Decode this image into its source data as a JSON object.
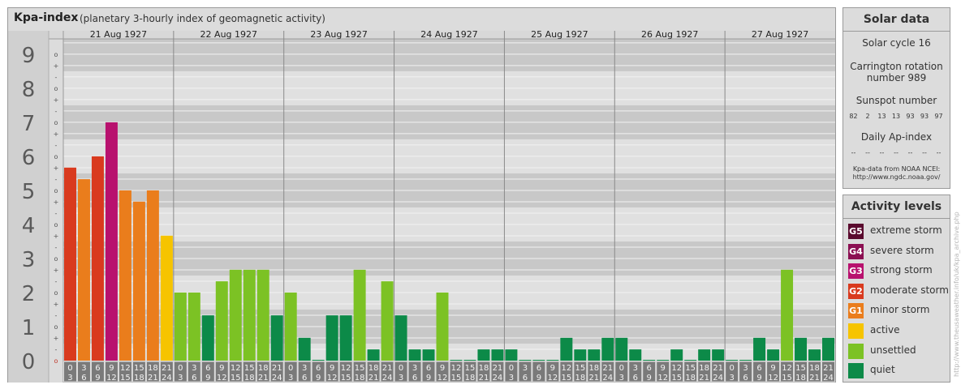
{
  "title": {
    "main": "Kpa-index",
    "sub": "(planetary 3-hourly index of geomagnetic activity)"
  },
  "solar_data": {
    "heading": "Solar data",
    "cycle": "Solar cycle 16",
    "carrington_line1": "Carrington rotation",
    "carrington_line2": "number 989",
    "sunspot_heading": "Sunspot number",
    "sunspot_values": [
      "82",
      "2",
      "13",
      "13",
      "93",
      "93",
      "97"
    ],
    "ap_heading": "Daily Ap-index",
    "ap_values": [
      "--",
      "--",
      "--",
      "--",
      "--",
      "--",
      "--"
    ],
    "source_line1": "Kpa-data from NOAA NCEI:",
    "source_line2": "http://www.ngdc.noaa.gov/"
  },
  "activity_levels": {
    "heading": "Activity levels",
    "items": [
      {
        "badge": "G5",
        "label": "extreme storm",
        "color": "#5a0a2e"
      },
      {
        "badge": "G4",
        "label": "severe storm",
        "color": "#8b0f52"
      },
      {
        "badge": "G3",
        "label": "strong storm",
        "color": "#b8116e"
      },
      {
        "badge": "G2",
        "label": "moderate storm",
        "color": "#d93a1e"
      },
      {
        "badge": "G1",
        "label": "minor storm",
        "color": "#ea7d1c"
      },
      {
        "badge": "",
        "label": "active",
        "color": "#f6c400"
      },
      {
        "badge": "",
        "label": "unsettled",
        "color": "#7cc224"
      },
      {
        "badge": "",
        "label": "quiet",
        "color": "#0c8a48"
      }
    ]
  },
  "watermark": "http://www.theusaweather.info/uk/kpa_archive.php",
  "chart_data": {
    "type": "bar",
    "title": "Kpa-index",
    "ylim": [
      0,
      9
    ],
    "y_ticks": [
      "0",
      "1",
      "2",
      "3",
      "4",
      "5",
      "6",
      "7",
      "8",
      "9"
    ],
    "y_subticks": [
      "o",
      "-",
      "+",
      "o",
      "-",
      "+",
      "o",
      "-",
      "+",
      "o",
      "-",
      "+",
      "o",
      "-",
      "+",
      "o",
      "-",
      "+",
      "o",
      "-",
      "+",
      "o",
      "-",
      "+",
      "o",
      "-",
      "+",
      "o"
    ],
    "days": [
      "21 Aug 1927",
      "22 Aug 1927",
      "23 Aug 1927",
      "24 Aug 1927",
      "25 Aug 1927",
      "26 Aug 1927",
      "27 Aug 1927"
    ],
    "interval_starts": [
      "0",
      "3",
      "6",
      "9",
      "12",
      "15",
      "18",
      "21"
    ],
    "interval_ends": [
      "3",
      "6",
      "9",
      "12",
      "15",
      "18",
      "21",
      "24"
    ],
    "values": [
      5.67,
      5.33,
      6.0,
      7.0,
      5.0,
      4.67,
      5.0,
      3.67,
      2.0,
      2.0,
      1.33,
      2.33,
      2.67,
      2.67,
      2.67,
      1.33,
      2.0,
      0.67,
      0.0,
      1.33,
      1.33,
      2.67,
      0.33,
      2.33,
      1.33,
      0.33,
      0.33,
      2.0,
      0.0,
      0.0,
      0.33,
      0.33,
      0.33,
      0.0,
      0.0,
      0.0,
      0.67,
      0.33,
      0.33,
      0.67,
      0.67,
      0.33,
      0.0,
      0.0,
      0.33,
      0.0,
      0.33,
      0.33,
      0.0,
      0.0,
      0.67,
      0.33,
      2.67,
      0.67,
      0.33,
      0.67
    ],
    "colors": {
      "quiet": "#0c8a48",
      "unsettled": "#7cc224",
      "active": "#f6c400",
      "G1": "#ea7d1c",
      "G2": "#d93a1e",
      "G3": "#b8116e",
      "G4": "#8b0f52",
      "G5": "#5a0a2e"
    }
  }
}
